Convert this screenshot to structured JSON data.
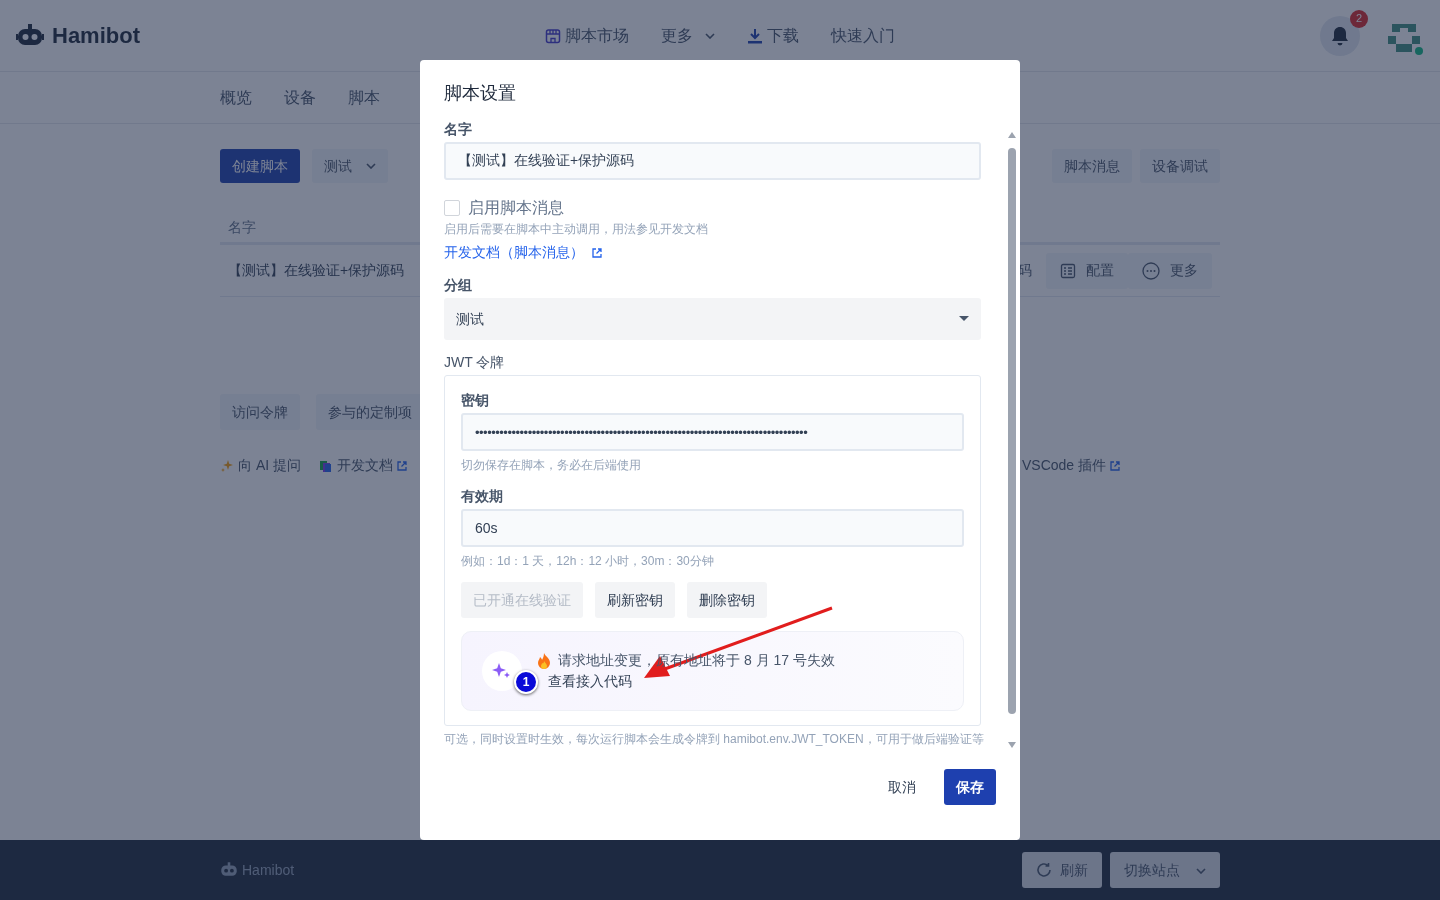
{
  "header": {
    "brand": "Hamibot",
    "nav": [
      {
        "label": "脚本市场",
        "dropdown": false
      },
      {
        "label": "更多",
        "dropdown": true
      },
      {
        "label": "下载",
        "dropdown": false
      },
      {
        "label": "快速入门",
        "dropdown": false
      }
    ],
    "notification_count": "2"
  },
  "subnav": [
    "概览",
    "设备",
    "脚本"
  ],
  "toolbar": {
    "create_button": "创建脚本",
    "group_filter": {
      "label": "测试",
      "dropdown": true
    },
    "right_buttons": [
      "脚本消息",
      "设备调试"
    ]
  },
  "table": {
    "columns": [
      "名字"
    ],
    "rows": [
      {
        "name": "【测试】在线验证+保护源码",
        "actions": [
          "码",
          "配置",
          "更多"
        ]
      }
    ]
  },
  "bottom_buttons": [
    "访问令牌",
    "参与的定制项"
  ],
  "links": [
    {
      "label": "向 AI 提问",
      "external": false
    },
    {
      "label": "开发文档",
      "external": true
    }
  ],
  "right_link": {
    "label": "VSCode 插件",
    "external": true
  },
  "modal": {
    "title": "脚本设置",
    "name_label": "名字",
    "name_value": "【测试】在线验证+保护源码",
    "message_checkbox": {
      "label": "启用脚本消息",
      "checked": false
    },
    "message_help": "启用后需要在脚本中主动调用，用法参见开发文档",
    "doc_link": "开发文档（脚本消息）",
    "group_label": "分组",
    "group_value": "测试",
    "jwt_label": "JWT 令牌",
    "secret_label": "密钥",
    "secret_value": "••••••••••••••••••••••••••••••••••••••••••••••••••••••••••••••••••••••••••••••••••",
    "secret_help": "切勿保存在脚本，务必在后端使用",
    "expiry_label": "有效期",
    "expiry_value": "60s",
    "expiry_help": "例如：1d：1 天，12h：12 小时，30m：30分钟",
    "actions": [
      {
        "label": "已开通在线验证",
        "disabled": true
      },
      {
        "label": "刷新密钥",
        "disabled": false
      },
      {
        "label": "删除密钥",
        "disabled": false
      }
    ],
    "notice": {
      "text": "请求地址变更，原有地址将于 8 月 17 号失效",
      "link": "查看接入代码"
    },
    "jwt_help": "可选，同时设置时生效，每次运行脚本会生成令牌到 hamibot.env.JWT_TOKEN，可用于做后端验证等",
    "cancel": "取消",
    "save": "保存"
  },
  "footer": {
    "brand": "Hamibot",
    "buttons": [
      {
        "label": "刷新",
        "dropdown": false
      },
      {
        "label": "切换站点",
        "dropdown": true
      }
    ]
  },
  "annotation": {
    "marker": "1"
  }
}
